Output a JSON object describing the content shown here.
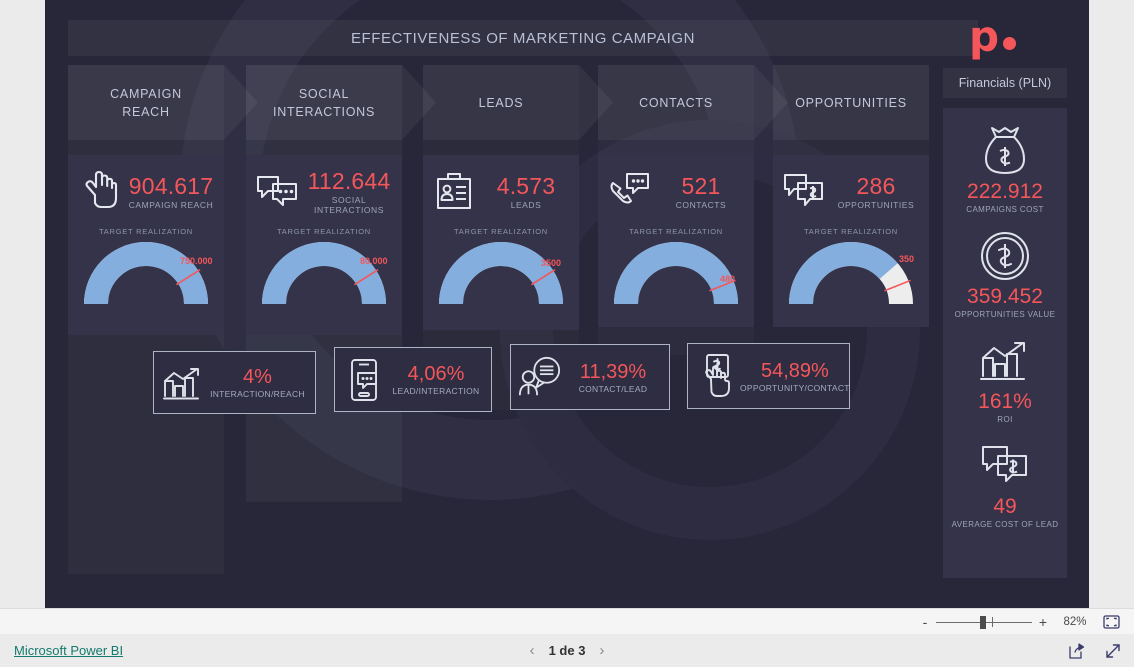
{
  "report": {
    "title": "EFFECTIVENESS OF MARKETING CAMPAIGN",
    "logo_letter": "p",
    "accent_red": "#f4565a",
    "gauge_blue": "#84aede",
    "canvas_bg": "#282739",
    "card_bg": "#343349"
  },
  "funnel_stages": [
    {
      "label": "CAMPAIGN\nREACH"
    },
    {
      "label": "SOCIAL\nINTERACTIONS"
    },
    {
      "label": "LEADS"
    },
    {
      "label": "CONTACTS"
    },
    {
      "label": "OPPORTUNITIES"
    }
  ],
  "kpis": [
    {
      "value": "904.617",
      "label": "CAMPAIGN REACH",
      "target_caption": "TARGET REALIZATION",
      "target_value": "750.000",
      "icon": "hand-pointer-icon",
      "fill_pct": 100,
      "needle_pct": 82
    },
    {
      "value": "112.644",
      "label": "SOCIAL INTERACTIONS",
      "target_caption": "TARGET REALIZATION",
      "target_value": "80.000",
      "icon": "chat-bubbles-icon",
      "fill_pct": 100,
      "needle_pct": 82
    },
    {
      "value": "4.573",
      "label": "LEADS",
      "target_caption": "TARGET REALIZATION",
      "target_value": "3500",
      "icon": "id-badge-icon",
      "fill_pct": 100,
      "needle_pct": 82
    },
    {
      "value": "521",
      "label": "CONTACTS",
      "target_caption": "TARGET REALIZATION",
      "target_value": "480",
      "icon": "phone-chat-icon",
      "fill_pct": 100,
      "needle_pct": 88
    },
    {
      "value": "286",
      "label": "OPPORTUNITIES",
      "target_caption": "TARGET REALIZATION",
      "target_value": "350",
      "icon": "chat-dollar-icon",
      "fill_pct": 77,
      "needle_pct": 88
    }
  ],
  "conversions": [
    {
      "value": "4%",
      "label": "INTERACTION/REACH",
      "icon": "bar-chart-arrow-icon"
    },
    {
      "value": "4,06%",
      "label": "LEAD/INTERACTION",
      "icon": "mobile-chat-icon"
    },
    {
      "value": "11,39%",
      "label": "CONTACT/LEAD",
      "icon": "person-speech-icon"
    },
    {
      "value": "54,89%",
      "label": "OPPORTUNITY/CONTACT",
      "icon": "hand-money-card-icon"
    }
  ],
  "financials": {
    "title": "Financials (PLN)",
    "items": [
      {
        "value": "222.912",
        "label": "CAMPAIGNS COST",
        "icon": "money-bag-icon"
      },
      {
        "value": "359.452",
        "label": "OPPORTUNITIES VALUE",
        "icon": "dollar-coin-icon"
      },
      {
        "value": "161%",
        "label": "ROI",
        "icon": "bar-chart-arrow-icon"
      },
      {
        "value": "49",
        "label": "AVERAGE COST OF LEAD",
        "icon": "chat-dollar-icon"
      }
    ]
  },
  "zoombar": {
    "minus": "-",
    "plus": "+",
    "percent": "82%",
    "fit_icon": "fit-to-page-icon"
  },
  "statusbar": {
    "brand": "Microsoft Power BI",
    "page_indicator": "1 de 3",
    "prev_icon": "chevron-left-icon",
    "next_icon": "chevron-right-icon",
    "share_icon": "share-icon",
    "fullscreen_icon": "fullscreen-icon"
  }
}
